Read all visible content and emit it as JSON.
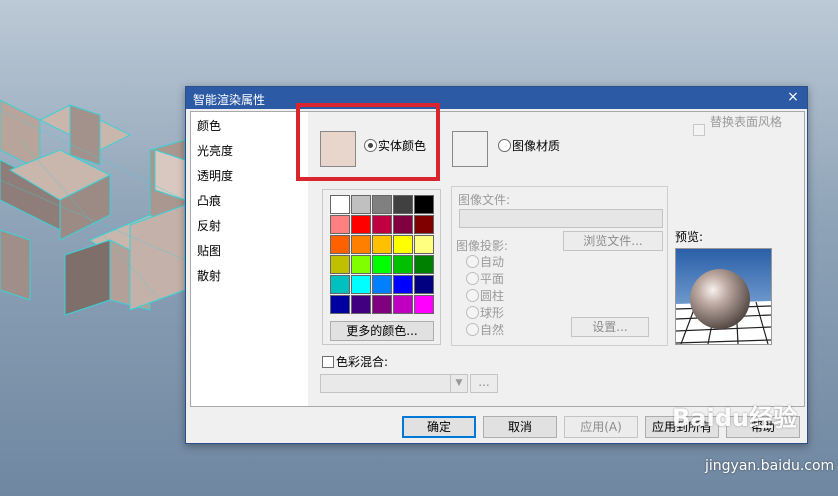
{
  "dialog": {
    "title": "智能渲染属性",
    "close_glyph": "×"
  },
  "nav": {
    "items": [
      "颜色",
      "光亮度",
      "透明度",
      "凸痕",
      "反射",
      "贴图",
      "散射"
    ]
  },
  "color_tab": {
    "solid_color_label": "实体颜色",
    "solid_color_selected": true,
    "solid_color_value": "#e8d6cc",
    "image_material_label": "图像材质",
    "replace_surface_style_label": "替换表面风格",
    "more_colors_label": "更多的颜色...",
    "palette": [
      "#ffffff",
      "#c0c0c0",
      "#808080",
      "#404040",
      "#000000",
      "#ff8080",
      "#ff0000",
      "#c00040",
      "#800040",
      "#800000",
      "#ff6000",
      "#ff8000",
      "#ffc000",
      "#ffff00",
      "#ffff80",
      "#c0c000",
      "#80ff00",
      "#00ff00",
      "#00c000",
      "#008000",
      "#00c0c0",
      "#00ffff",
      "#0080ff",
      "#0000ff",
      "#000080",
      "#0000a0",
      "#400080",
      "#800080",
      "#c000c0",
      "#ff00ff"
    ],
    "image_file_label": "图像文件:",
    "browse_label": "浏览文件...",
    "projection_label": "图像投影:",
    "projection_options": [
      "自动",
      "平面",
      "圆柱",
      "球形",
      "自然"
    ],
    "settings_label": "设置...",
    "preview_label": "预览:",
    "blend_label": "色彩混合:",
    "blend_more_label": "..."
  },
  "buttons": {
    "ok": "确定",
    "cancel": "取消",
    "apply": "应用(A)",
    "apply_all": "应用到所有",
    "help": "帮助"
  },
  "watermark": {
    "brand": "Baidu经验",
    "url": "jingyan.baidu.com"
  }
}
